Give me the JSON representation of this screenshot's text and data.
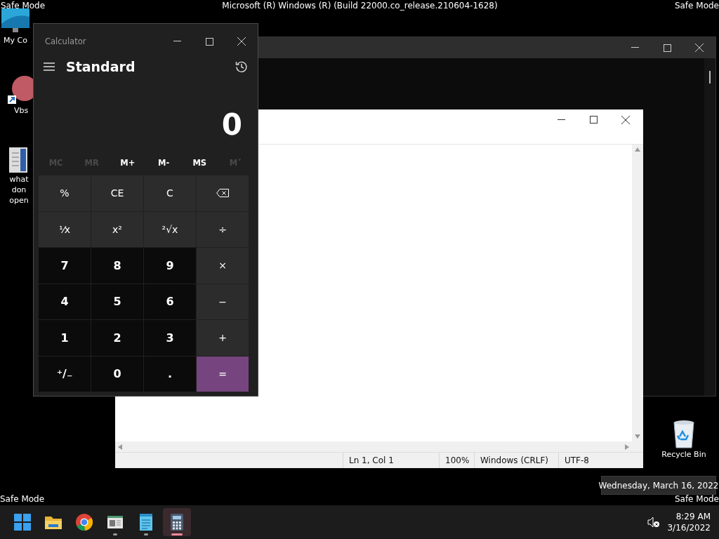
{
  "desktop": {
    "top_left_label": "Safe Mode",
    "top_title": "Microsoft (R) Windows (R) (Build 22000.co_release.210604-1628)",
    "top_right_label": "Safe Mode",
    "bottom_left_label": "Safe Mode",
    "bottom_right_label": "Safe Mode",
    "icons": [
      {
        "kind": "monitor",
        "lines": [
          "My Co"
        ]
      },
      {
        "kind": "ball",
        "lines": [
          "Vbs"
        ]
      },
      {
        "kind": "document",
        "lines": [
          "what",
          "don",
          "open"
        ]
      },
      {
        "kind": "recycle",
        "lines": [
          "Recycle Bin"
        ]
      }
    ]
  },
  "notepad": {
    "status": [
      "Ln 1, Col 1",
      "100%",
      "Windows (CRLF)",
      "UTF-8"
    ]
  },
  "calculator": {
    "title": "Calculator",
    "mode": "Standard",
    "display": "0",
    "memory": [
      {
        "label": "MC",
        "disabled": true
      },
      {
        "label": "MR",
        "disabled": true
      },
      {
        "label": "M+",
        "disabled": false
      },
      {
        "label": "M-",
        "disabled": false
      },
      {
        "label": "MS",
        "disabled": false
      },
      {
        "label": "M˅",
        "disabled": true
      }
    ],
    "keys": [
      {
        "kind": "function",
        "label": "%"
      },
      {
        "kind": "function",
        "label": "CE"
      },
      {
        "kind": "function",
        "label": "C"
      },
      {
        "kind": "backspace"
      },
      {
        "kind": "function",
        "label": "⅟x"
      },
      {
        "kind": "function",
        "label": "x²"
      },
      {
        "kind": "function",
        "label": "²√x"
      },
      {
        "kind": "function",
        "label": "÷"
      },
      {
        "kind": "digit",
        "label": "7"
      },
      {
        "kind": "digit",
        "label": "8"
      },
      {
        "kind": "digit",
        "label": "9"
      },
      {
        "kind": "function",
        "label": "×"
      },
      {
        "kind": "digit",
        "label": "4"
      },
      {
        "kind": "digit",
        "label": "5"
      },
      {
        "kind": "digit",
        "label": "6"
      },
      {
        "kind": "function",
        "label": "−"
      },
      {
        "kind": "digit",
        "label": "1"
      },
      {
        "kind": "digit",
        "label": "2"
      },
      {
        "kind": "digit",
        "label": "3"
      },
      {
        "kind": "function",
        "label": "+"
      },
      {
        "kind": "digit",
        "label": "⁺/₋"
      },
      {
        "kind": "digit",
        "label": "0"
      },
      {
        "kind": "digit",
        "label": "."
      },
      {
        "kind": "equals",
        "label": "="
      }
    ]
  },
  "tooltip": "Wednesday, March 16, 2022",
  "taskbar": {
    "apps": [
      {
        "kind": "start",
        "running": false,
        "selected": false
      },
      {
        "kind": "explorer",
        "running": false,
        "selected": false
      },
      {
        "kind": "chrome",
        "running": false,
        "selected": false
      },
      {
        "kind": "app-window",
        "running": true,
        "selected": false
      },
      {
        "kind": "notepad",
        "running": true,
        "selected": false
      },
      {
        "kind": "calculator",
        "running": true,
        "selected": true
      }
    ],
    "time": "8:29 AM",
    "date": "3/16/2022"
  }
}
